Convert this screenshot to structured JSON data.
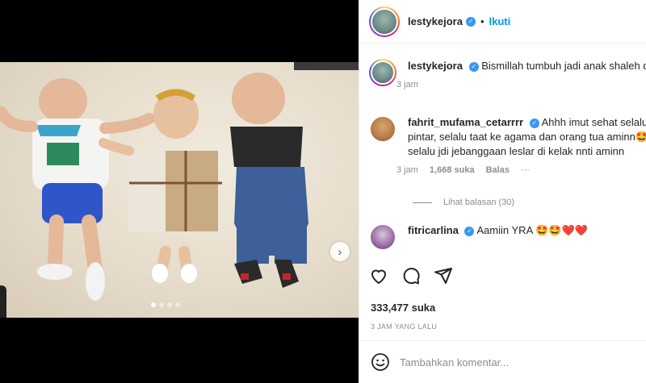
{
  "post": {
    "username": "lestykejora",
    "follow_label": "Ikuti",
    "separator": "•"
  },
  "comments": [
    {
      "username": "lestykejora",
      "text": "Bismillah tumbuh jadi anak shaleh dan shalehah",
      "time": "3 jam"
    },
    {
      "username": "fahrit_mufama_cetarrrr",
      "line1": "Ahhh imut sehat selalu ya",
      "line2": "pintar, selalu taat ke agama dan orang tua aminn🤩",
      "line3": "selalu jdi jebanggaan leslar di kelak nnti aminn",
      "time": "3 jam",
      "likes": "1,668 suka",
      "reply_label": "Balas",
      "more": "···",
      "view_replies": "Lihat balasan (30)"
    },
    {
      "username": "fitricarlina",
      "text": "Aamiin YRA 🤩🤩❤️❤️"
    }
  ],
  "footer": {
    "likes": "333,477 suka",
    "timestamp": "3 JAM YANG LALU",
    "comment_placeholder": "Tambahkan komentar..."
  },
  "carousel": {
    "total": 4,
    "active": 0
  },
  "icons": {
    "like": "heart-icon",
    "comment": "comment-icon",
    "share": "share-icon",
    "emoji": "emoji-icon",
    "next": "chevron-right-icon",
    "verified": "verified-badge-icon"
  },
  "colors": {
    "link": "#0095f6",
    "verified": "#3897f0",
    "muted": "#8e8e8e"
  }
}
